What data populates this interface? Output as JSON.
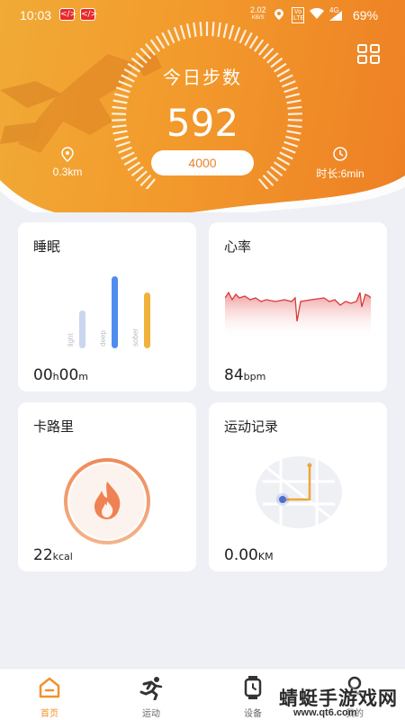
{
  "status_bar": {
    "time": "10:03",
    "net_speed": "2.02",
    "net_speed_unit": "KB/S",
    "volte": "Vo LTE",
    "network": "4G",
    "battery": "69%"
  },
  "header": {
    "steps_label": "今日步数",
    "steps": "592",
    "goal": "4000",
    "distance": "0.3km",
    "duration": "时长:6min"
  },
  "cards": {
    "sleep": {
      "title": "睡眠",
      "value_h": "00",
      "unit_h": "h",
      "value_m": "00",
      "unit_m": "m",
      "bars": [
        {
          "label": "light",
          "level": 0.42,
          "color": "#c9d6ee"
        },
        {
          "label": "deep",
          "level": 0.8,
          "color": "#4f8cf0"
        },
        {
          "label": "sober",
          "level": 0.62,
          "color": "#f0b23a"
        }
      ]
    },
    "heart": {
      "title": "心率",
      "value": "84",
      "unit": "bpm"
    },
    "calorie": {
      "title": "卡路里",
      "value": "22",
      "unit": "kcal"
    },
    "record": {
      "title": "运动记录",
      "value": "0.00",
      "unit": "KM"
    }
  },
  "nav": {
    "items": [
      {
        "label": "首页",
        "active": true
      },
      {
        "label": "运动",
        "active": false
      },
      {
        "label": "设备",
        "active": false
      },
      {
        "label": "我的",
        "active": false
      }
    ]
  },
  "watermark": {
    "title": "蜻蜓手游戏网",
    "url": "www.qt6.com"
  },
  "colors": {
    "accent": "#f0922e",
    "header_start": "#f1aa36",
    "header_end": "#ee7f24",
    "heart_line": "#d93a3a"
  }
}
